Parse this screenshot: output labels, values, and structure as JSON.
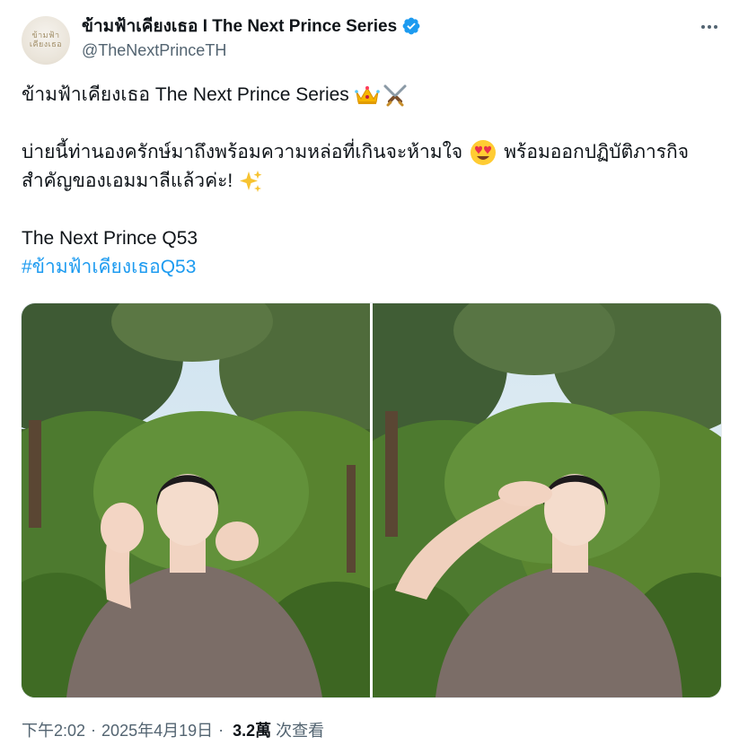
{
  "author": {
    "display_name": "ข้ามฟ้าเคียงเธอ I The Next Prince Series",
    "handle": "@TheNextPrinceTH",
    "avatar_text": "ข้ามฟ้า เคียงเธอ",
    "verified": true,
    "verified_color": "#1d9bf0"
  },
  "tweet": {
    "lines": [
      "ข้ามฟ้าเคียงเธอ The Next Prince Series",
      "",
      "บ่ายนี้ท่านองครักษ์มาถึงพร้อมความหล่อที่เกินจะห้ามใจ",
      "สำคัญของเอมมาลีแล้วค่ะ!",
      "",
      "The Next Prince Q53"
    ],
    "line3_after_emoji": "พร้อมออกปฏิบัติภารกิจ",
    "hashtag": "#ข้ามฟ้าเคียงเธอQ53",
    "emojis": [
      "crown-emoji",
      "crossed-swords-emoji",
      "heart-eyes-emoji",
      "sparkles-emoji"
    ]
  },
  "media": {
    "count": 2,
    "photos": [
      "photo-left",
      "photo-right"
    ]
  },
  "meta": {
    "time": "下午2:02",
    "separator": "·",
    "date": "2025年4月19日",
    "views_count": "3.2萬",
    "views_label": "次查看"
  },
  "colors": {
    "text": "#0f1419",
    "secondary": "#536471",
    "link": "#1d9bf0"
  }
}
